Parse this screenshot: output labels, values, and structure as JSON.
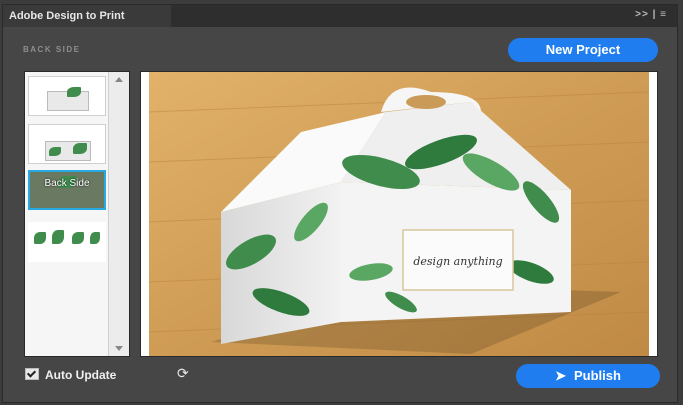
{
  "window": {
    "title": "Adobe Design to Print",
    "menu": ">> | ≡"
  },
  "side_label": "BACK SIDE",
  "actions": {
    "new_project": "New Project",
    "publish": "Publish"
  },
  "thumbnails": [
    {
      "label": ""
    },
    {
      "label": ""
    },
    {
      "label": "Back Side"
    },
    {
      "label": ""
    }
  ],
  "preview": {
    "box_text": "design anything"
  },
  "footer": {
    "auto_update": "Auto Update"
  },
  "colors": {
    "accent": "#1f7df0",
    "selection": "#27a9e1",
    "panel": "#464646",
    "wood": "#d6a45e",
    "leaf": "#3f8c4d"
  },
  "icons": [
    "panel-menu-icon",
    "checkbox-icon",
    "refresh-icon",
    "send-icon"
  ]
}
